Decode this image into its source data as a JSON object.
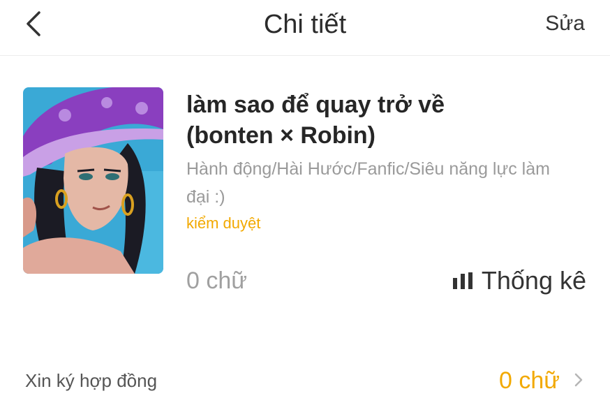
{
  "header": {
    "title": "Chi tiết",
    "edit_label": "Sửa",
    "back_icon": "chevron-left-icon"
  },
  "book": {
    "title": "làm sao để quay trở về\n(bonten × Robin)",
    "genres": "Hành động/Hài Hước/Fanfic/Siêu năng lực làm đại :)",
    "status": "kiểm duyệt",
    "word_count": "0 chữ",
    "stats_label": "Thống kê",
    "stats_icon": "bar-chart-icon"
  },
  "contract": {
    "label": "Xin ký hợp đồng",
    "value": "0 chữ",
    "chevron_icon": "chevron-right-icon"
  },
  "colors": {
    "accent": "#f2a900",
    "text": "#2b2b2b",
    "muted": "#9a9a9a"
  }
}
